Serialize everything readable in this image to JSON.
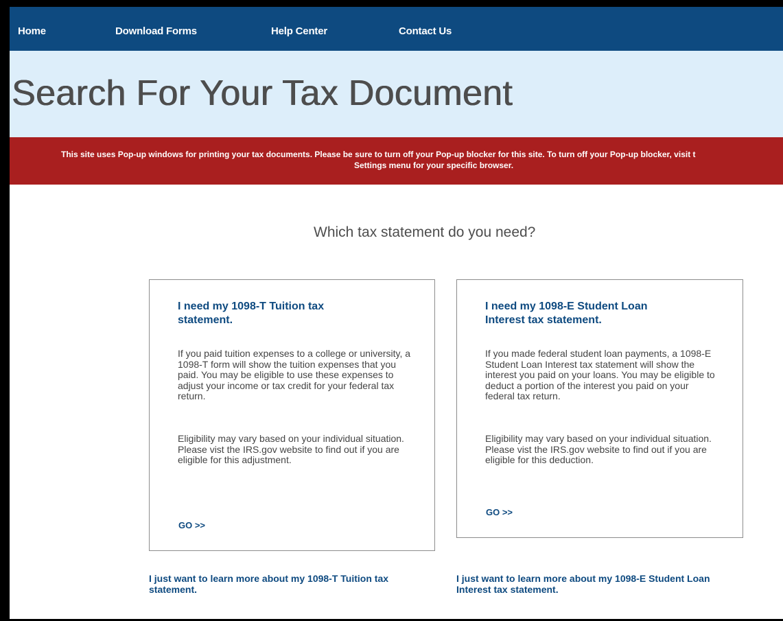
{
  "nav": {
    "home": "Home",
    "download_forms": "Download Forms",
    "help_center": "Help Center",
    "contact_us": "Contact Us"
  },
  "hero": {
    "title": "Search For Your Tax Document"
  },
  "alert": {
    "line1": "This site uses Pop-up windows for printing your tax documents. Please be sure to turn off your Pop-up blocker for this site. To turn off your Pop-up blocker, visit t",
    "line2": "Settings menu for your specific browser."
  },
  "main": {
    "question": "Which tax statement do you need?"
  },
  "cards": [
    {
      "title": "I need my 1098-T Tuition tax statement.",
      "paragraph1": "If you paid tuition expenses to a college or university, a 1098-T form will show the tuition expenses that you paid. You may be eligible to use these expenses to adjust your income or tax credit for your federal tax return.",
      "paragraph2": "Eligibility may vary based on your individual situation. Please vist the IRS.gov website to find out if you are eligible for this adjustment.",
      "go": "GO >>",
      "learn_more": "I just want to learn more about my 1098-T Tuition tax statement."
    },
    {
      "title": "I need my 1098-E Student Loan Interest tax statement.",
      "paragraph1": "If you made federal student loan payments, a 1098-E Student Loan Interest tax statement will show the interest you paid on your loans. You may be eligible to deduct a portion of the interest you paid on your federal tax return.",
      "paragraph2": "Eligibility may vary based on your individual situation. Please vist the IRS.gov website to find out if you are eligible for this deduction.",
      "go": "GO >>",
      "learn_more": "I just want to learn more about my 1098-E Student Loan Interest tax statement."
    }
  ],
  "colors": {
    "nav_background": "#0e4a80",
    "hero_background": "#ddeefa",
    "alert_background": "#a91f1f",
    "link": "#0e4a80",
    "heading_text": "#4d4d4d"
  }
}
